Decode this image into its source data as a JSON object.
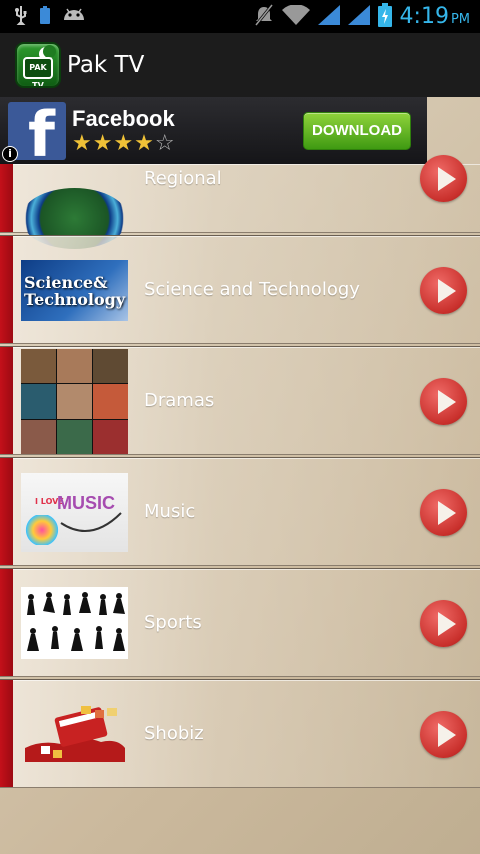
{
  "status_bar": {
    "time": "4:19",
    "ampm": "PM",
    "icons": [
      "usb-icon",
      "battery-small-icon",
      "android-icon",
      "mute-icon",
      "wifi-icon",
      "signal-icon",
      "signal-icon",
      "battery-charging-icon"
    ]
  },
  "action_bar": {
    "logo_text": "PAK TV",
    "title": "Pak TV"
  },
  "ad": {
    "title": "Facebook",
    "logo_letter": "f",
    "stars_filled": "★★★★",
    "stars_empty": "☆",
    "rating": 4,
    "button": "DOWNLOAD",
    "info": "i"
  },
  "list": {
    "items": [
      {
        "label": "Regional"
      },
      {
        "label": "Science and Technology",
        "thumb_line1": "Science&",
        "thumb_line2": "Technology"
      },
      {
        "label": "Dramas"
      },
      {
        "label": "Music",
        "thumb_text": "MUSIC",
        "thumb_small": "I LOVE"
      },
      {
        "label": "Sports"
      },
      {
        "label": "Shobiz"
      }
    ]
  },
  "colors": {
    "accent_red": "#c4101a",
    "time_blue": "#35b6ea",
    "download_green": "#5cb321",
    "facebook_blue": "#3b5998"
  }
}
